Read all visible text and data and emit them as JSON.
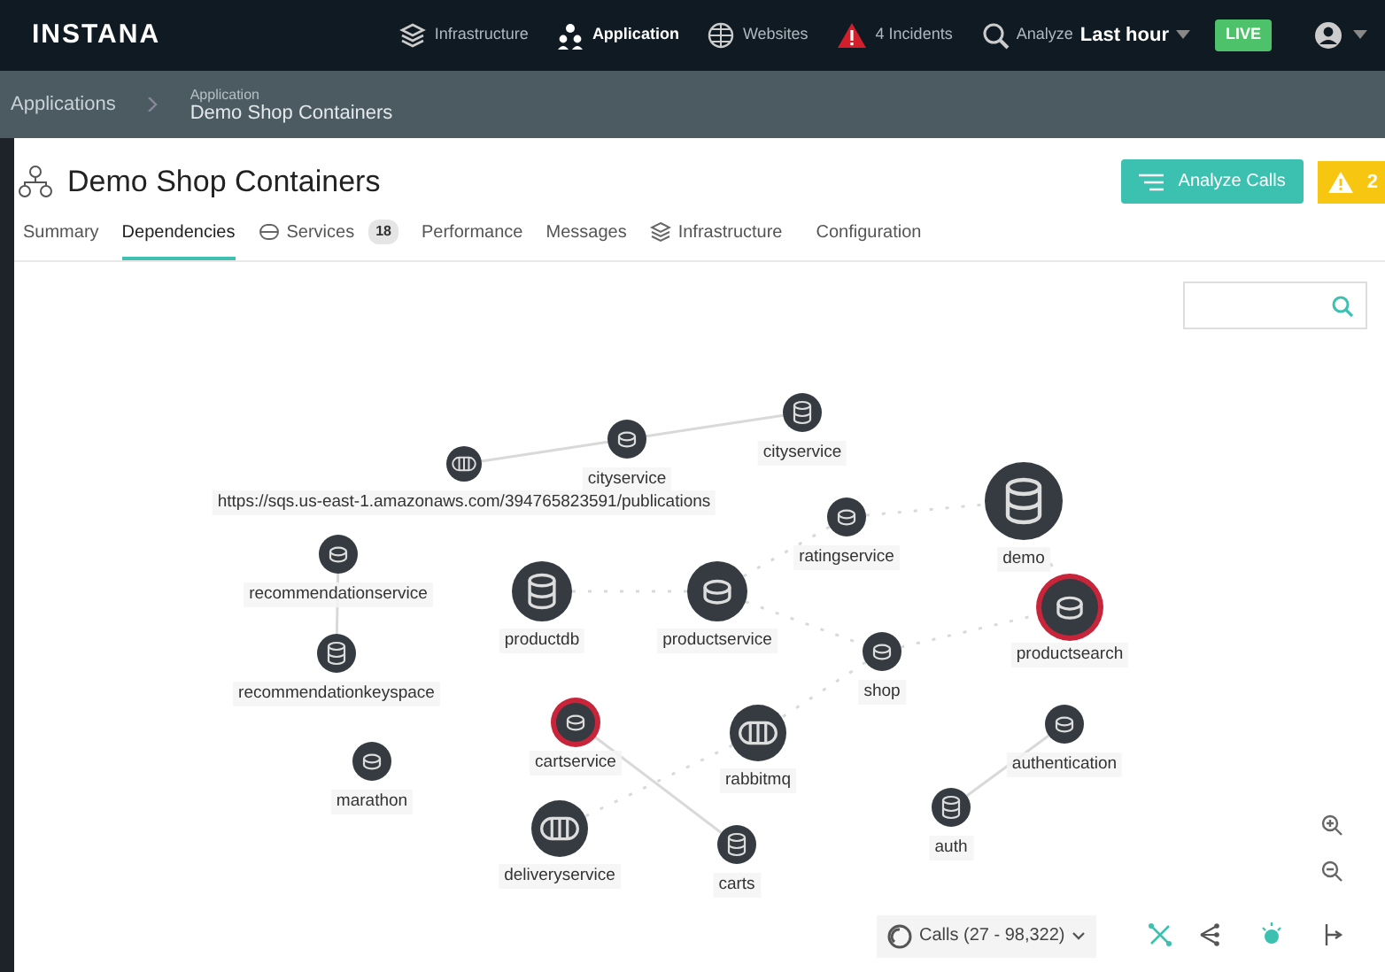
{
  "topbar": {
    "brand": "INSTANA",
    "items": [
      {
        "label": "Infrastructure",
        "selected": false
      },
      {
        "label": "Application",
        "selected": true
      },
      {
        "label": "Websites",
        "selected": false
      }
    ],
    "incidents": "4 Incidents",
    "analyze": {
      "label": "Analyze",
      "range": "Last hour"
    },
    "live": "LIVE"
  },
  "breadcrumb": {
    "parent": "Applications",
    "caption": "Application",
    "current": "Demo Shop Containers"
  },
  "header": {
    "title": "Demo Shop Containers",
    "analyze_button": "Analyze Calls",
    "alert_count": "2"
  },
  "tabs": [
    {
      "label": "Summary",
      "selected": false
    },
    {
      "label": "Dependencies",
      "selected": true
    },
    {
      "label": "Services",
      "count": "18",
      "selected": false
    },
    {
      "label": "Performance",
      "selected": false
    },
    {
      "label": "Messages",
      "selected": false
    },
    {
      "label": "Infrastructure",
      "selected": false
    },
    {
      "label": "Configuration",
      "selected": false
    }
  ],
  "graph": {
    "nodes": [
      {
        "label": "https://sqs.us-east-1.amazonaws.com/394765823591/publications",
        "kind": "queue",
        "alert": false
      },
      {
        "label": "cityservice",
        "kind": "service",
        "alert": false
      },
      {
        "label": "cityservice",
        "kind": "database",
        "alert": false
      },
      {
        "label": "ratingservice",
        "kind": "service",
        "alert": false
      },
      {
        "label": "demo",
        "kind": "database",
        "alert": false
      },
      {
        "label": "recommendationservice",
        "kind": "service",
        "alert": false
      },
      {
        "label": "productdb",
        "kind": "database",
        "alert": false
      },
      {
        "label": "productservice",
        "kind": "service",
        "alert": false
      },
      {
        "label": "productsearch",
        "kind": "service",
        "alert": true
      },
      {
        "label": "recommendationkeyspace",
        "kind": "database",
        "alert": false
      },
      {
        "label": "shop",
        "kind": "service",
        "alert": false
      },
      {
        "label": "cartservice",
        "kind": "service",
        "alert": true
      },
      {
        "label": "rabbitmq",
        "kind": "queue",
        "alert": false
      },
      {
        "label": "authentication",
        "kind": "service",
        "alert": false
      },
      {
        "label": "marathon",
        "kind": "service",
        "alert": false
      },
      {
        "label": "deliveryservice",
        "kind": "queue",
        "alert": false
      },
      {
        "label": "carts",
        "kind": "database",
        "alert": false
      },
      {
        "label": "auth",
        "kind": "database",
        "alert": false
      }
    ],
    "calls_filter": "Calls (27 - 98,322)"
  }
}
